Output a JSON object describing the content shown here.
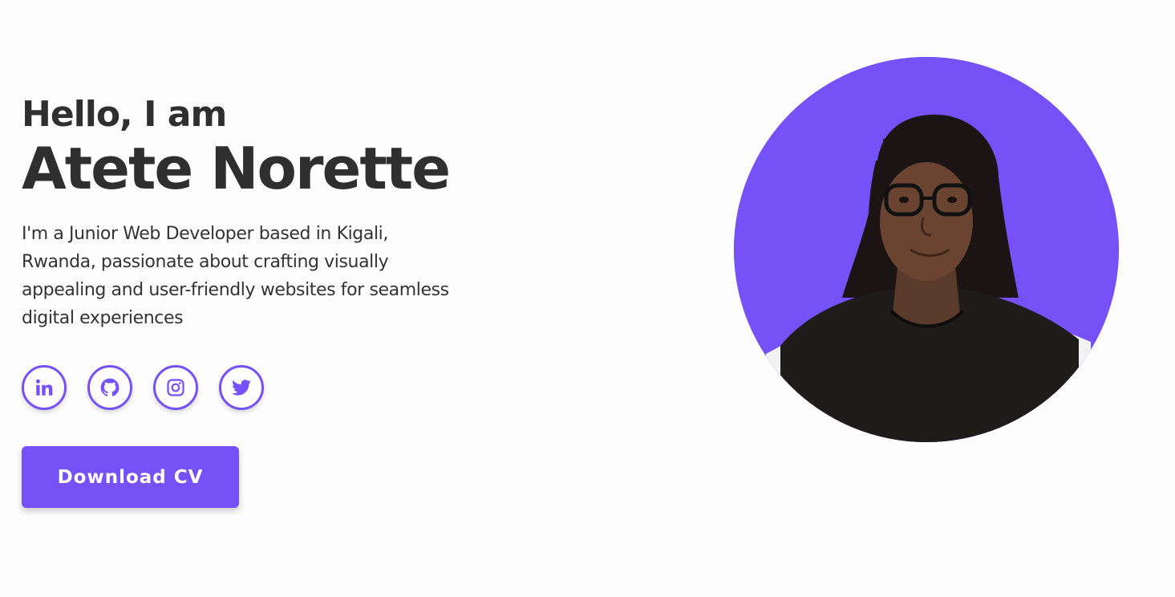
{
  "hero": {
    "greeting": "Hello, I am",
    "name": "Atete Norette",
    "bio": "I'm a Junior Web Developer based in Kigali, Rwanda, passionate about crafting visually appealing and user-friendly websites for seamless digital experiences",
    "cta_label": "Download CV",
    "socials": [
      {
        "name": "linkedin",
        "icon": "linkedin-icon"
      },
      {
        "name": "github",
        "icon": "github-icon"
      },
      {
        "name": "instagram",
        "icon": "instagram-icon"
      },
      {
        "name": "twitter",
        "icon": "twitter-icon"
      }
    ],
    "portrait_icon": "profile-photo"
  },
  "colors": {
    "accent": "#7551f7",
    "text": "#2f2f2f",
    "background": "#fdfdfd"
  }
}
